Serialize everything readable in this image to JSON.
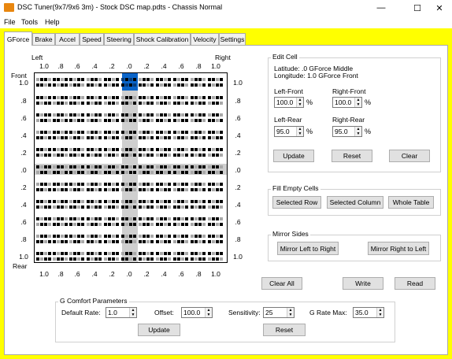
{
  "window": {
    "title": "DSC Tuner(9x7/9x6 3m) - Stock DSC map.pdts - Chassis Normal",
    "minimize": "—",
    "maximize": "☐",
    "close": "✕"
  },
  "menu": [
    "File",
    "Tools",
    "Help"
  ],
  "tabs": [
    "GForce",
    "Brake",
    "Accel",
    "Speed",
    "Steering",
    "Shock Calibration",
    "Velocity",
    "Settings"
  ],
  "grid": {
    "left_label": "Left",
    "right_label": "Right",
    "front_label": "Front",
    "rear_label": "Rear",
    "col_labels": [
      "1.0",
      ".8",
      ".6",
      ".4",
      ".2",
      ".0",
      ".2",
      ".4",
      ".6",
      ".8",
      "1.0"
    ],
    "row_labels_left": [
      "1.0",
      ".8",
      ".6",
      ".4",
      ".2",
      ".0",
      ".2",
      ".4",
      ".6",
      ".8",
      "1.0"
    ],
    "row_labels_right": [
      "1.0",
      ".8",
      ".6",
      ".4",
      ".2",
      ".0",
      ".2",
      ".4",
      ".6",
      ".8",
      "1.0"
    ],
    "selected_cell": {
      "latitude": ".0",
      "longitude": "1.0"
    }
  },
  "edit_cell": {
    "title": "Edit Cell",
    "latitude_line": "Latitude: .0 GForce Middle",
    "longitude_line": "Longitude: 1.0 GForce Front",
    "left_front_label": "Left-Front",
    "left_front_value": "100.0",
    "right_front_label": "Right-Front",
    "right_front_value": "100.0",
    "left_rear_label": "Left-Rear",
    "left_rear_value": "95.0",
    "right_rear_label": "Right-Rear",
    "right_rear_value": "95.0",
    "pct": "%",
    "update": "Update",
    "reset": "Reset",
    "clear": "Clear"
  },
  "fill_empty": {
    "title": "Fill Empty Cells",
    "selected_row": "Selected Row",
    "selected_column": "Selected Column",
    "whole_table": "Whole Table"
  },
  "mirror": {
    "title": "Mirror Sides",
    "left_to_right": "Mirror Left to Right",
    "right_to_left": "Mirror Right to Left"
  },
  "actions": {
    "clear_all": "Clear All",
    "write": "Write",
    "read": "Read"
  },
  "comfort": {
    "title": "G Comfort Parameters",
    "default_rate_label": "Default Rate:",
    "default_rate_value": "1.0",
    "offset_label": "Offset:",
    "offset_value": "100.0",
    "sensitivity_label": "Sensitivity:",
    "sensitivity_value": "25",
    "g_rate_max_label": "G Rate Max:",
    "g_rate_max_value": "35.0",
    "update": "Update",
    "reset": "Reset"
  },
  "colors": {
    "background": "#ffff00",
    "selected_cell": "#0a64c8",
    "highlight": "#cfcfcf",
    "accent_icon": "#e8860f"
  }
}
